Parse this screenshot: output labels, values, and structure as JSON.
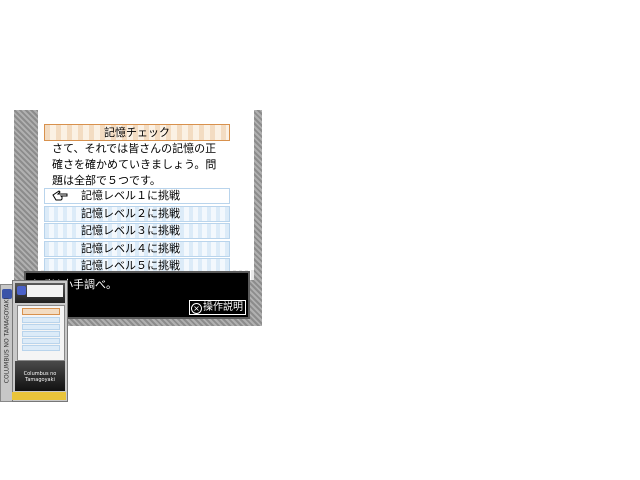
{
  "game": {
    "title": "記憶チェック",
    "body_lines": [
      "さて、それでは皆さんの記憶の正",
      "確さを確かめていきましょう。問",
      "題は全部で５つです。"
    ],
    "menu": [
      {
        "label": "記憶レベル１に挑戦",
        "selected": true
      },
      {
        "label": "記憶レベル２に挑戦",
        "selected": false
      },
      {
        "label": "記憶レベル３に挑戦",
        "selected": false
      },
      {
        "label": "記憶レベル４に挑戦",
        "selected": false
      },
      {
        "label": "記憶レベル５に挑戦",
        "selected": false
      }
    ],
    "dialog_text": "まずは小手調べ。",
    "help_button": "操作説明",
    "cursor_icon": "pointing-hand-icon",
    "accent_title": "#d8914d",
    "accent_menu": "#b9d4ec"
  },
  "box_art": {
    "spine_text": "COLUMBUS NO TAMAGOYAKI",
    "front_caption": "Columbus no Tamagoyaki"
  }
}
